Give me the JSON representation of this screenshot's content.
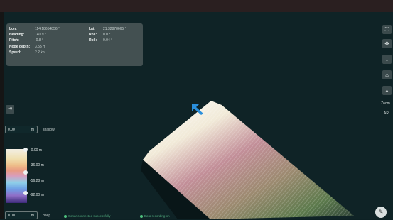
{
  "info_panel": {
    "rows": [
      {
        "label": "Lon:",
        "value": "114.18654856 °",
        "label2": "Lat:",
        "value2": "21.32878665 °"
      },
      {
        "label": "Heading:",
        "value": "140.9 °",
        "label2": "Roll:",
        "value2": "0.0 °"
      },
      {
        "label": "Pitch:",
        "value": "-0.8 °",
        "label2": "Roll:",
        "value2": "0.04 °"
      },
      {
        "label": "Node depth:",
        "value": "3.55 m",
        "label2": "",
        "value2": ""
      },
      {
        "label": "Speed:",
        "value": "2.2 kn",
        "label2": "",
        "value2": ""
      }
    ]
  },
  "toolbar": {
    "icons": [
      "expand-icon",
      "compass-icon",
      "layers-icon",
      "home-icon",
      "person-icon"
    ],
    "glyphs": [
      "⛶",
      "✥",
      "⌄",
      "⌂",
      "⅄"
    ],
    "zoom_label": "Zoom",
    "zoom_value": "AR"
  },
  "collapse_glyph": "⇥",
  "shallow": {
    "value": "0.00",
    "unit": "m",
    "label": "shallow"
  },
  "deep": {
    "value": "0.00",
    "unit": "m",
    "label": "deep"
  },
  "colorbar": {
    "ticks": [
      "-0.00 m",
      "-36.00 m",
      "-56.28 m",
      "-92.00 m"
    ]
  },
  "status": {
    "items": [
      "Sonar connected successfully",
      "Data recording on"
    ]
  },
  "bottom_button_glyph": "✎",
  "colors": {
    "background": "#0f2326",
    "top_bar": "#2a1f20",
    "info_panel": "#5c6464",
    "status_green": "#4fc07e",
    "arrow": "#2a8fdc"
  }
}
